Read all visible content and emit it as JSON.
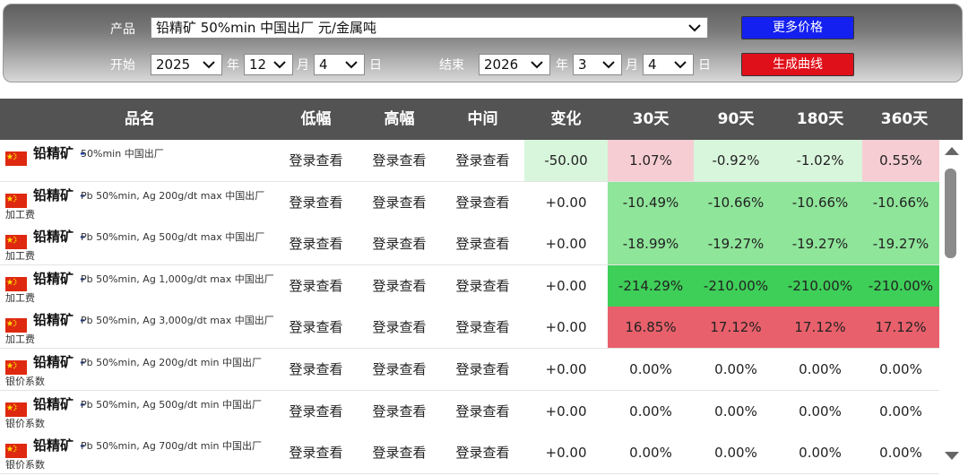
{
  "filters": {
    "product_label": "产品",
    "product_value": "铅精矿 50%min 中国出厂 元/金属吨",
    "more_prices_label": "更多价格",
    "generate_curve_label": "生成曲线",
    "start_label": "开始",
    "end_label": "结束",
    "start_year": "2025",
    "start_month": "12",
    "start_day": "4",
    "end_year": "2026",
    "end_month": "3",
    "end_day": "4",
    "year_unit": "年",
    "month_unit": "月",
    "day_unit": "日"
  },
  "table": {
    "headers": [
      "品名",
      "低幅",
      "高幅",
      "中间",
      "变化",
      "30天",
      "90天",
      "180天",
      "360天"
    ],
    "login_text": "登录查看",
    "rows": [
      {
        "name": "铅精矿",
        "spec": "50%min 中国出厂",
        "type": "",
        "change": "-50.00",
        "d30": "1.07%",
        "d90": "-0.92%",
        "d180": "-1.02%",
        "d360": "0.55%"
      },
      {
        "name": "铅精矿",
        "spec": "Pb 50%min, Ag 200g/dt max 中国出厂",
        "type": "加工费",
        "change": "+0.00",
        "d30": "-10.49%",
        "d90": "-10.66%",
        "d180": "-10.66%",
        "d360": "-10.66%"
      },
      {
        "name": "铅精矿",
        "spec": "Pb 50%min, Ag 500g/dt max 中国出厂",
        "type": "加工费",
        "change": "+0.00",
        "d30": "-18.99%",
        "d90": "-19.27%",
        "d180": "-19.27%",
        "d360": "-19.27%"
      },
      {
        "name": "铅精矿",
        "spec": "Pb 50%min, Ag 1,000g/dt max 中国出厂",
        "type": "加工费",
        "change": "+0.00",
        "d30": "-214.29%",
        "d90": "-210.00%",
        "d180": "-210.00%",
        "d360": "-210.00%"
      },
      {
        "name": "铅精矿",
        "spec": "Pb 50%min, Ag 3,000g/dt max 中国出厂",
        "type": "加工费",
        "change": "+0.00",
        "d30": "16.85%",
        "d90": "17.12%",
        "d180": "17.12%",
        "d360": "17.12%"
      },
      {
        "name": "铅精矿",
        "spec": "Pb 50%min, Ag 200g/dt min 中国出厂",
        "type": "银价系数",
        "change": "+0.00",
        "d30": "0.00%",
        "d90": "0.00%",
        "d180": "0.00%",
        "d360": "0.00%"
      },
      {
        "name": "铅精矿",
        "spec": "Pb 50%min, Ag 500g/dt min 中国出厂",
        "type": "银价系数",
        "change": "+0.00",
        "d30": "0.00%",
        "d90": "0.00%",
        "d180": "0.00%",
        "d360": "0.00%"
      },
      {
        "name": "铅精矿",
        "spec": "Pb 50%min, Ag 700g/dt min 中国出厂",
        "type": "银价系数",
        "change": "+0.00",
        "d30": "0.00%",
        "d90": "0.00%",
        "d180": "0.00%",
        "d360": "0.00%"
      }
    ],
    "cell_colors": [
      {
        "change": "#d8f6dc",
        "d30": "#f6cdd2",
        "d90": "#d8f6dc",
        "d180": "#d8f6dc",
        "d360": "#f6cdd2"
      },
      {
        "change": "",
        "d30": "#8fe59a",
        "d90": "#8fe59a",
        "d180": "#8fe59a",
        "d360": "#8fe59a"
      },
      {
        "change": "",
        "d30": "#8fe59a",
        "d90": "#8fe59a",
        "d180": "#8fe59a",
        "d360": "#8fe59a"
      },
      {
        "change": "",
        "d30": "#3ecf58",
        "d90": "#3ecf58",
        "d180": "#3ecf58",
        "d360": "#3ecf58"
      },
      {
        "change": "",
        "d30": "#e8606b",
        "d90": "#e8606b",
        "d180": "#e8606b",
        "d360": "#e8606b"
      },
      {
        "change": "",
        "d30": "",
        "d90": "",
        "d180": "",
        "d360": ""
      },
      {
        "change": "",
        "d30": "",
        "d90": "",
        "d180": "",
        "d360": ""
      },
      {
        "change": "",
        "d30": "",
        "d90": "",
        "d180": "",
        "d360": ""
      }
    ]
  },
  "icons": {
    "flag": "china-flag-icon",
    "dropdown": "chevron-down-icon",
    "scroll_up": "scroll-up-arrow-icon",
    "scroll_down": "scroll-down-arrow-icon"
  },
  "colors": {
    "header_bg": "#535353",
    "button_blue": "#1420f0",
    "button_red": "#e0101a"
  }
}
